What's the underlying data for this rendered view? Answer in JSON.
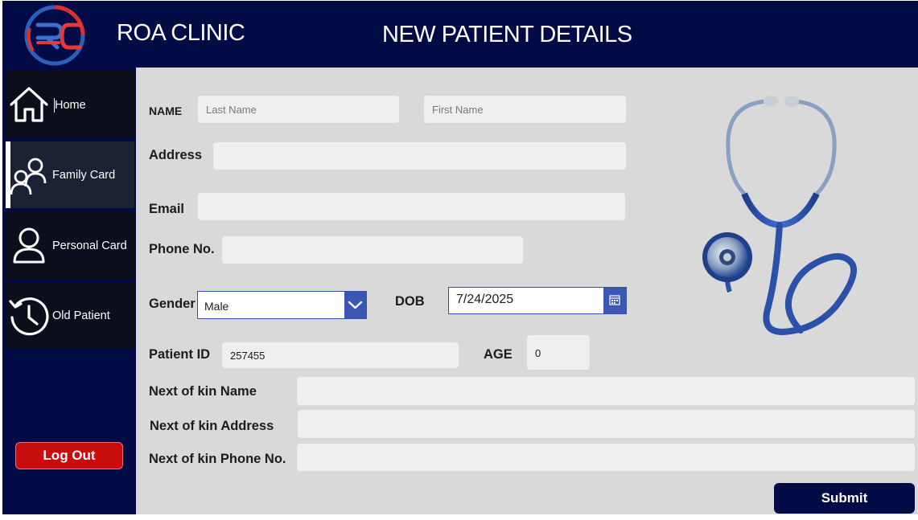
{
  "header": {
    "clinic_name": "ROA CLINIC",
    "page_title": "NEW PATIENT DETAILS"
  },
  "sidebar": {
    "items": [
      {
        "label": "Home",
        "icon": "home-icon"
      },
      {
        "label": "Family Card",
        "icon": "family-icon"
      },
      {
        "label": "Personal Card",
        "icon": "person-icon"
      },
      {
        "label": "Old Patient",
        "icon": "history-icon"
      }
    ],
    "logout_label": "Log Out"
  },
  "form": {
    "name_label": "NAME",
    "last_name_placeholder": "Last Name",
    "first_name_placeholder": "First Name",
    "address_label": "Address",
    "email_label": "Email",
    "phone_label": "Phone No.",
    "gender_label": "Gender",
    "gender_value": "Male",
    "dob_label": "DOB",
    "dob_value": "7/24/2025",
    "patient_id_label": "Patient ID",
    "patient_id_value": "257455",
    "age_label": "AGE",
    "age_value": "0",
    "kin_name_label": "Next of kin Name",
    "kin_address_label": "Next of kin Address",
    "kin_phone_label": "Next of kin Phone No.",
    "submit_label": "Submit"
  },
  "colors": {
    "navy": "#030b47",
    "logout_red": "#c70d0d",
    "accent_blue": "#3a58b3",
    "content_bg": "#d9d9d9"
  }
}
